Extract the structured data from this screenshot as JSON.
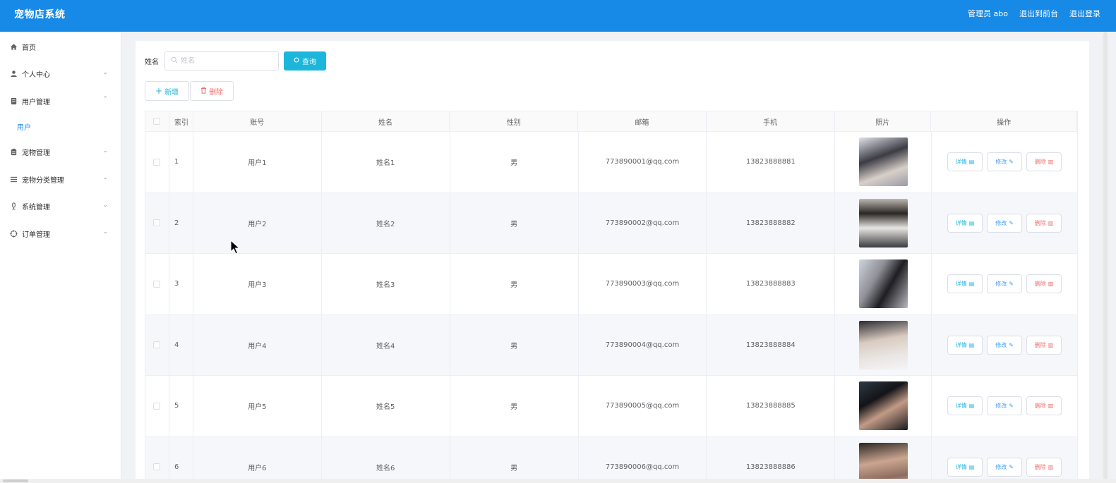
{
  "app": {
    "title": "宠物店系统"
  },
  "header": {
    "user": "管理员 abo",
    "to_front": "退出到前台",
    "logout": "退出登录"
  },
  "sidebar": {
    "items": [
      {
        "label": "首页",
        "icon": "home-icon",
        "arrow": ""
      },
      {
        "label": "个人中心",
        "icon": "person-icon",
        "arrow": "⌄"
      },
      {
        "label": "用户管理",
        "icon": "document-icon",
        "arrow": "⌃"
      },
      {
        "label": "宠物管理",
        "icon": "clipboard-icon",
        "arrow": "⌄"
      },
      {
        "label": "宠物分类管理",
        "icon": "list-icon",
        "arrow": "⌄"
      },
      {
        "label": "系统管理",
        "icon": "mic-icon",
        "arrow": "⌄"
      },
      {
        "label": "订单管理",
        "icon": "compass-icon",
        "arrow": "⌄"
      }
    ],
    "sub_item": "用户"
  },
  "search": {
    "label": "姓名",
    "placeholder": "姓名",
    "button": "查询"
  },
  "actions": {
    "add": "新增",
    "delete": "删除"
  },
  "table": {
    "columns": [
      "",
      "索引",
      "账号",
      "姓名",
      "性别",
      "邮箱",
      "手机",
      "照片",
      "操作"
    ],
    "rows": [
      {
        "index": "1",
        "account": "用户1",
        "name": "姓名1",
        "sex": "男",
        "email": "773890001@qq.com",
        "phone": "13823888881"
      },
      {
        "index": "2",
        "account": "用户2",
        "name": "姓名2",
        "sex": "男",
        "email": "773890002@qq.com",
        "phone": "13823888882"
      },
      {
        "index": "3",
        "account": "用户3",
        "name": "姓名3",
        "sex": "男",
        "email": "773890003@qq.com",
        "phone": "13823888883"
      },
      {
        "index": "4",
        "account": "用户4",
        "name": "姓名4",
        "sex": "男",
        "email": "773890004@qq.com",
        "phone": "13823888884"
      },
      {
        "index": "5",
        "account": "用户5",
        "name": "姓名5",
        "sex": "男",
        "email": "773890005@qq.com",
        "phone": "13823888885"
      },
      {
        "index": "6",
        "account": "用户6",
        "name": "姓名6",
        "sex": "男",
        "email": "773890006@qq.com",
        "phone": "13823888886"
      }
    ],
    "op_detail": "详情",
    "op_edit": "修改",
    "op_delete": "删除"
  },
  "colors": {
    "header": "#1789e6",
    "accent": "#1cb6dc",
    "danger": "#f56c6c"
  }
}
